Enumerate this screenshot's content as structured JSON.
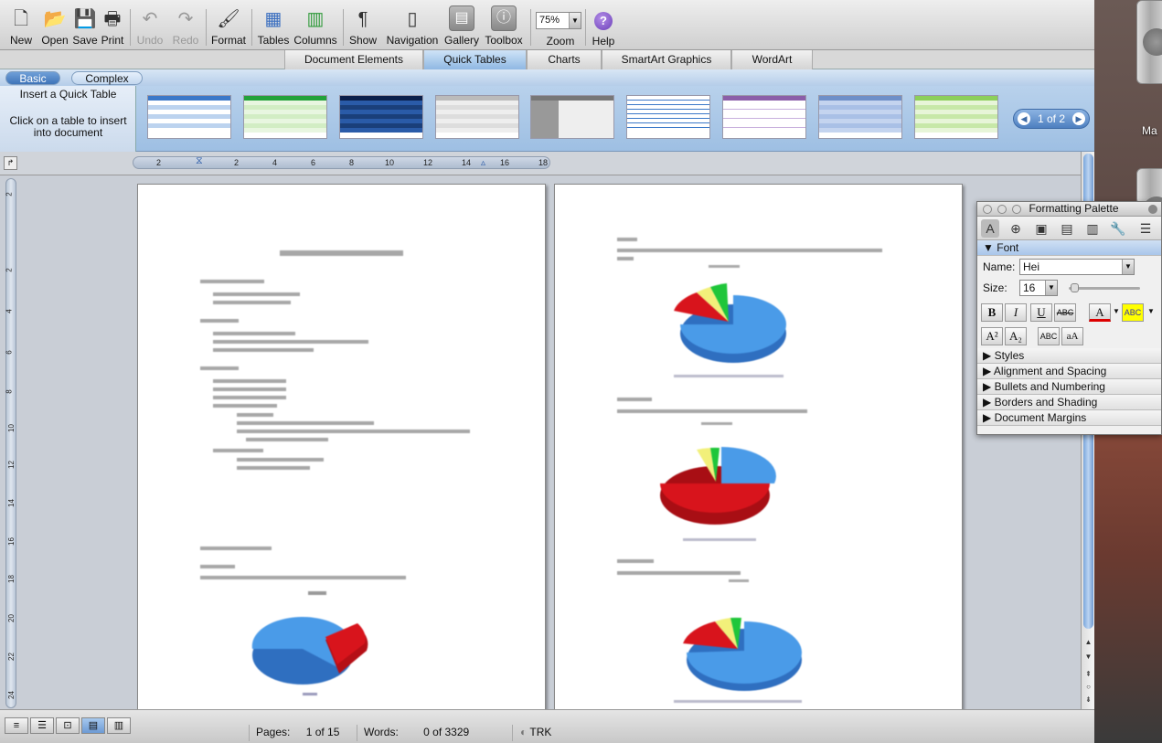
{
  "toolbar": {
    "new": "New",
    "open": "Open",
    "save": "Save",
    "print": "Print",
    "undo": "Undo",
    "redo": "Redo",
    "format": "Format",
    "tables": "Tables",
    "columns": "Columns",
    "show": "Show",
    "navigation": "Navigation",
    "gallery": "Gallery",
    "toolbox": "Toolbox",
    "zoom": "Zoom",
    "zoom_value": "75%",
    "help": "Help"
  },
  "ribbon_tabs": [
    "Document Elements",
    "Quick Tables",
    "Charts",
    "SmartArt Graphics",
    "WordArt"
  ],
  "gallery": {
    "modes": [
      "Basic",
      "Complex"
    ],
    "title": "Insert a Quick Table",
    "hint": "Click on a table to insert into document",
    "pager": "1 of 2"
  },
  "ruler": {
    "ticks": [
      "2",
      "2",
      "4",
      "6",
      "8",
      "10",
      "12",
      "14",
      "16",
      "18"
    ]
  },
  "vruler": {
    "ticks": [
      "2",
      "2",
      "4",
      "6",
      "8",
      "10",
      "12",
      "14",
      "16",
      "18",
      "20",
      "22",
      "24"
    ]
  },
  "status": {
    "pages_label": "Pages:",
    "pages_value": "1 of 15",
    "words_label": "Words:",
    "words_value": "0 of 3329",
    "trk": "TRK"
  },
  "palette": {
    "title": "Formatting Palette",
    "font_section": "Font",
    "name_label": "Name:",
    "name_value": "Hei",
    "size_label": "Size:",
    "size_value": "16",
    "sections": [
      "Styles",
      "Alignment and Spacing",
      "Bullets and Numbering",
      "Borders and Shading",
      "Document Margins"
    ],
    "abc_label": "ABC"
  },
  "desktop": {
    "label": "Ma"
  },
  "colors": {
    "accent": "#3f74b8",
    "pie_blue": "#4a9be8",
    "pie_red": "#d8141c",
    "pie_yellow": "#f2f07a",
    "pie_green": "#1fc63a"
  }
}
